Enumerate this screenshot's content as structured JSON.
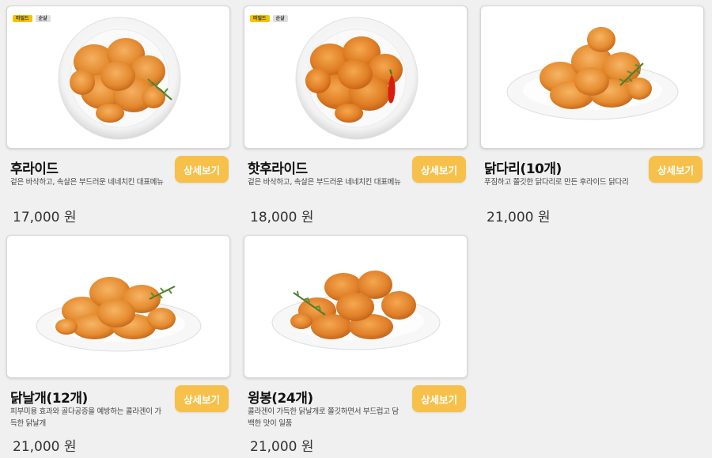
{
  "products": [
    {
      "name": "후라이드",
      "description": "겉은 바삭하고, 속살은 부드러운 네네치킨 대표메뉴",
      "price": "17,000 원",
      "button": "상세보기",
      "badges": [
        "마일드",
        "순살"
      ],
      "image": "fried-chicken-round-plate-icon"
    },
    {
      "name": "핫후라이드",
      "description": "겉은 바삭하고, 속살은 부드러운 네네치킨 대표메뉴",
      "price": "18,000 원",
      "button": "상세보기",
      "badges": [
        "마일드",
        "순살"
      ],
      "image": "hot-fried-chicken-round-plate-icon"
    },
    {
      "name": "닭다리(10개)",
      "description": "푸짐하고 쫄깃한 닭다리로 만든 후라이드 닭다리",
      "price": "21,000 원",
      "button": "상세보기",
      "badges": [],
      "image": "drumsticks-oval-plate-icon"
    },
    {
      "name": "닭날개(12개)",
      "description": "피부미용 효과와 골다공증을 예방하는 콜라겐이 가득한 닭날개",
      "price": "21,000 원",
      "button": "상세보기",
      "badges": [],
      "image": "wings-oval-plate-icon"
    },
    {
      "name": "윙봉(24개)",
      "description": "콜라겐이 가득한 닭날개로 쫄깃하면서 부드럽고 담백한 맛이 일품",
      "price": "21,000 원",
      "button": "상세보기",
      "badges": [],
      "image": "wingbong-oval-plate-icon"
    }
  ],
  "colors": {
    "button": "#f7c04a",
    "badge_mild": "#f5c400",
    "badge_boneless": "#dedede",
    "background": "#f0f0f0",
    "chicken": "#e8892a"
  }
}
